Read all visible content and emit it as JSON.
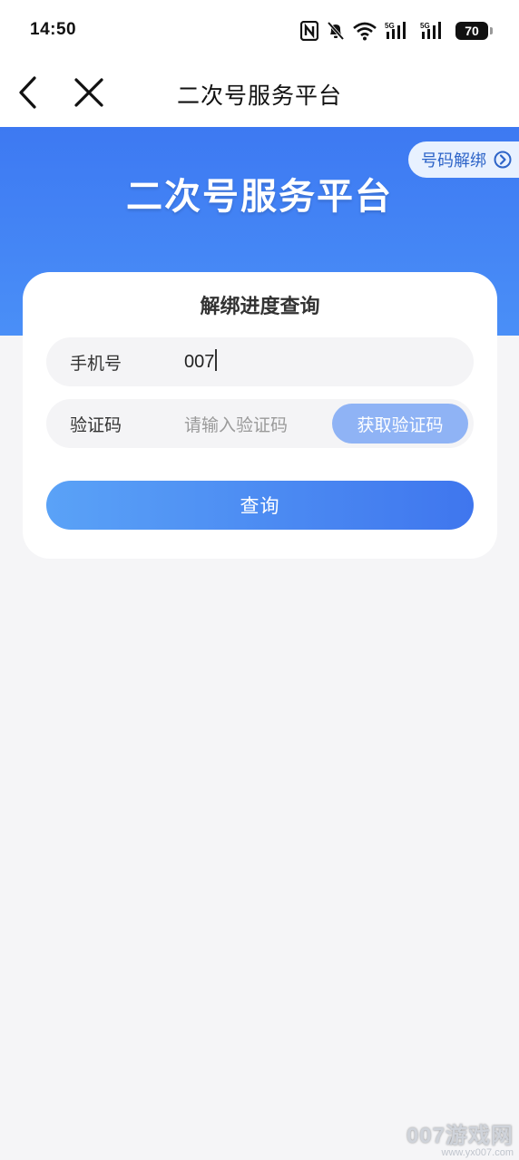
{
  "status_bar": {
    "time": "14:50",
    "battery": "70",
    "icons": [
      "nfc-icon",
      "bell-muted-icon",
      "wifi-icon",
      "signal-5g-icon",
      "signal-5g-icon",
      "battery-icon"
    ],
    "network_label": "5G"
  },
  "navbar": {
    "title": "二次号服务平台",
    "back_icon": "chevron-left-icon",
    "close_icon": "close-icon"
  },
  "hero": {
    "title": "二次号服务平台",
    "unbind_label": "号码解绑",
    "unbind_icon": "chevron-right-circle-icon"
  },
  "card": {
    "title": "解绑进度查询",
    "phone_label": "手机号",
    "phone_value": "007",
    "code_label": "验证码",
    "code_placeholder": "请输入验证码",
    "get_code_label": "获取验证码",
    "query_label": "查询"
  },
  "watermark": {
    "main": "007游戏网",
    "sub": "www.yx007.com"
  },
  "colors": {
    "primary": "#3d79f2",
    "get_code_bg": "#8fb3f5",
    "page_bg": "#f5f5f7"
  }
}
